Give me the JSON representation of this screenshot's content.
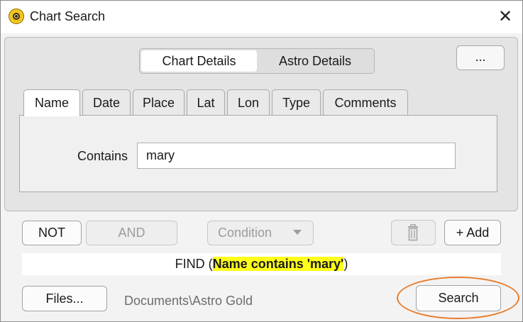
{
  "window": {
    "title": "Chart Search",
    "close_label": "✕"
  },
  "segmented": {
    "items": [
      {
        "label": "Chart Details",
        "active": true
      },
      {
        "label": "Astro Details",
        "active": false
      }
    ]
  },
  "more_button": {
    "label": "..."
  },
  "tabs": [
    {
      "label": "Name",
      "active": true
    },
    {
      "label": "Date"
    },
    {
      "label": "Place"
    },
    {
      "label": "Lat"
    },
    {
      "label": "Lon"
    },
    {
      "label": "Type"
    },
    {
      "label": "Comments"
    }
  ],
  "criteria": {
    "contains_label": "Contains",
    "contains_value": "mary"
  },
  "controls": {
    "not_label": "NOT",
    "and_label": "AND",
    "condition_label": "Condition",
    "add_label": "+ Add",
    "trash_icon": "trash-icon"
  },
  "find": {
    "prefix": "FIND (",
    "highlight": "Name contains 'mary'",
    "suffix": ")"
  },
  "footer": {
    "files_label": "Files...",
    "path": "Documents\\Astro Gold",
    "search_label": "Search"
  },
  "colors": {
    "highlight": "#ffff19",
    "annotation_ring": "#e87d2e",
    "app_icon": "#f2c61f"
  }
}
